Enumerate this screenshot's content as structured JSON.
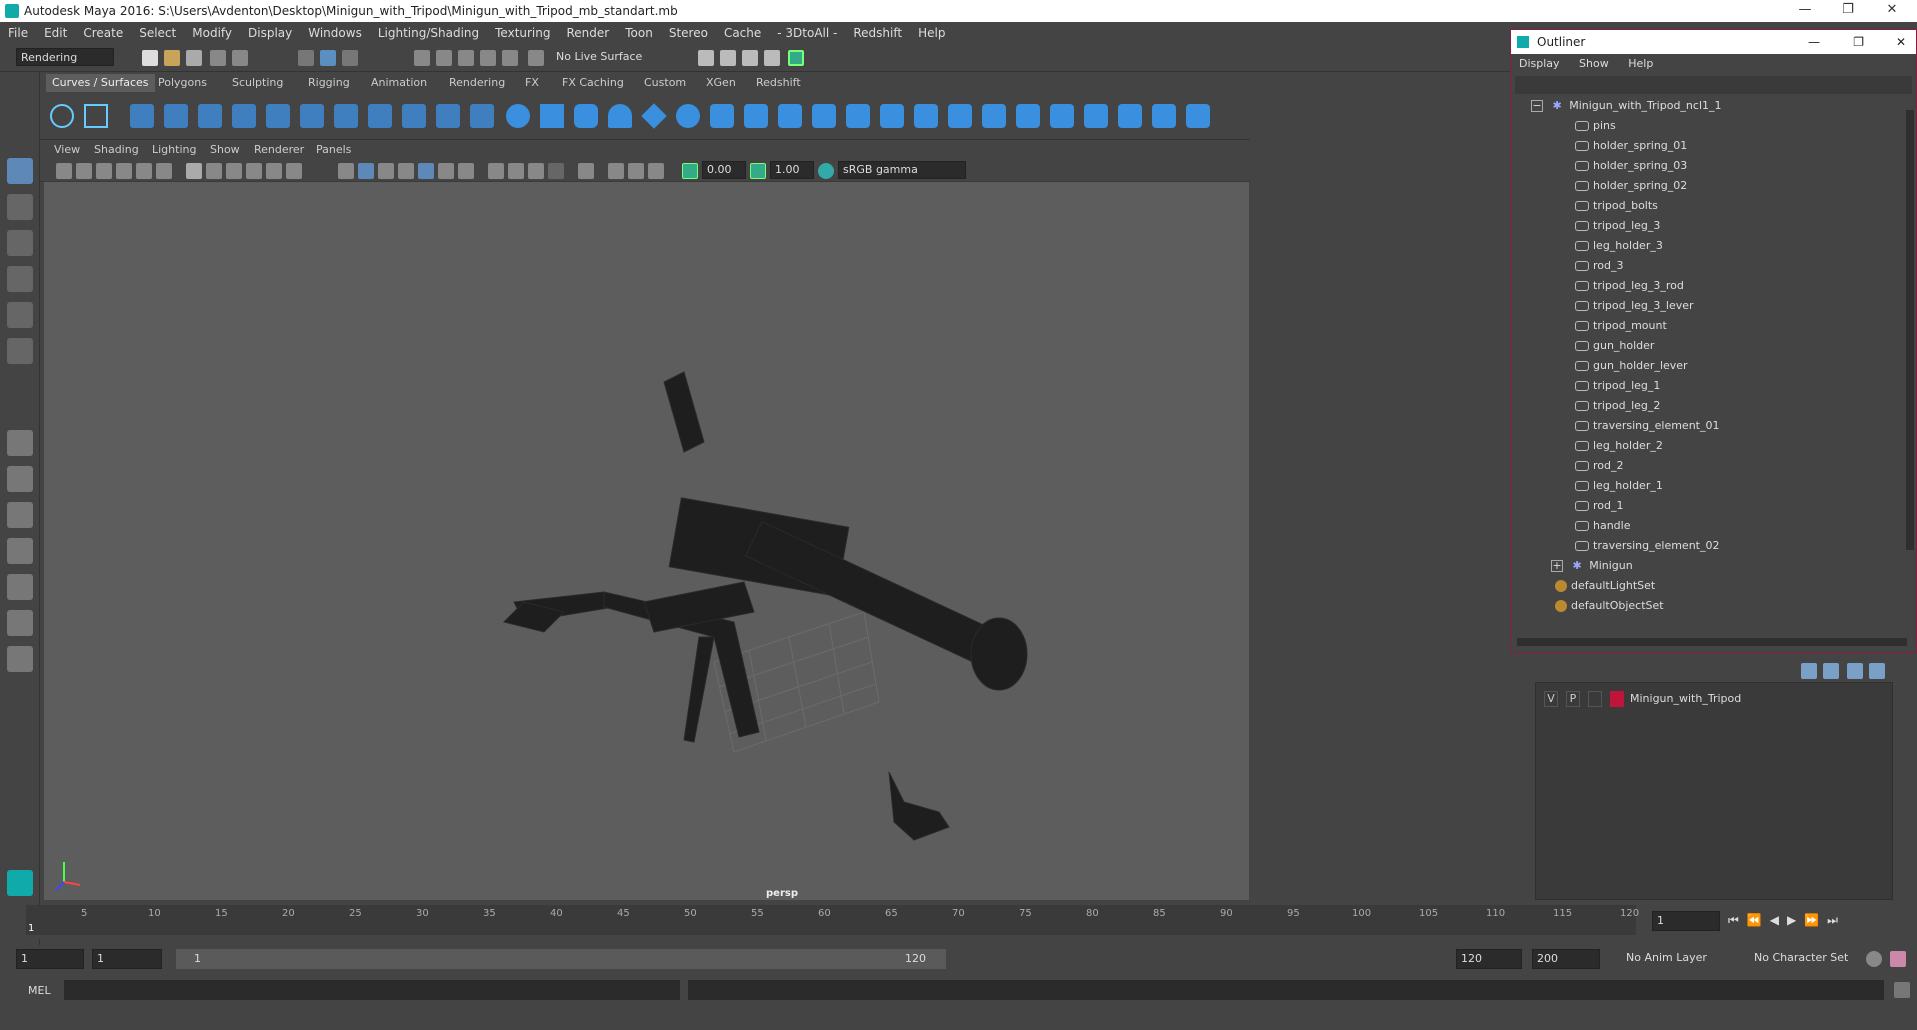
{
  "window": {
    "title": "Autodesk Maya 2016: S:\\Users\\Avdenton\\Desktop\\Minigun_with_Tripod\\Minigun_with_Tripod_mb_standart.mb",
    "minimize": "—",
    "maximize": "❐",
    "close": "✕"
  },
  "menubar": [
    "File",
    "Edit",
    "Create",
    "Select",
    "Modify",
    "Display",
    "Windows",
    "Lighting/Shading",
    "Texturing",
    "Render",
    "Toon",
    "Stereo",
    "Cache",
    "- 3DtoAll -",
    "Redshift",
    "Help"
  ],
  "status_line": {
    "mode_menu": "Rendering",
    "live_surface": "No Live Surface"
  },
  "shelf_tabs": [
    "Curves / Surfaces",
    "Polygons",
    "Sculpting",
    "Rigging",
    "Animation",
    "Rendering",
    "FX",
    "FX Caching",
    "Custom",
    "XGen",
    "Redshift"
  ],
  "viewport_menu": [
    "View",
    "Shading",
    "Lighting",
    "Show",
    "Renderer",
    "Panels"
  ],
  "viewport_toolbar": {
    "exposure": "0.00",
    "gamma": "1.00",
    "color_space": "sRGB gamma"
  },
  "viewport": {
    "camera_label": "persp"
  },
  "outliner": {
    "title": "Outliner",
    "menu": [
      "Display",
      "Show",
      "Help"
    ],
    "root": "Minigun_with_Tripod_ncl1_1",
    "children": [
      "pins",
      "holder_spring_01",
      "holder_spring_03",
      "holder_spring_02",
      "tripod_bolts",
      "tripod_leg_3",
      "leg_holder_3",
      "rod_3",
      "tripod_leg_3_rod",
      "tripod_leg_3_lever",
      "tripod_mount",
      "gun_holder",
      "gun_holder_lever",
      "tripod_leg_1",
      "tripod_leg_2",
      "traversing_element_01",
      "leg_holder_2",
      "rod_2",
      "leg_holder_1",
      "rod_1",
      "handle",
      "traversing_element_02"
    ],
    "group_child": "Minigun",
    "sets": [
      "defaultLightSet",
      "defaultObjectSet"
    ]
  },
  "layer_panel": {
    "layer": {
      "v": "V",
      "p": "P",
      "name": "Minigun_with_Tripod",
      "color": "#c0143c"
    }
  },
  "timeline": {
    "ticks": [
      "5",
      "10",
      "15",
      "20",
      "25",
      "30",
      "35",
      "40",
      "45",
      "50",
      "55",
      "60",
      "65",
      "70",
      "75",
      "80",
      "85",
      "90",
      "95",
      "100",
      "105",
      "110",
      "115",
      "120"
    ],
    "current_frame_marker": "1",
    "current_frame": "1"
  },
  "range": {
    "start": "1",
    "start2": "1",
    "slider_start": "1",
    "slider_end": "120",
    "end": "120",
    "end2": "200",
    "anim_layer": "No Anim Layer",
    "character_set": "No Character Set"
  },
  "command_line": {
    "label": "MEL"
  }
}
